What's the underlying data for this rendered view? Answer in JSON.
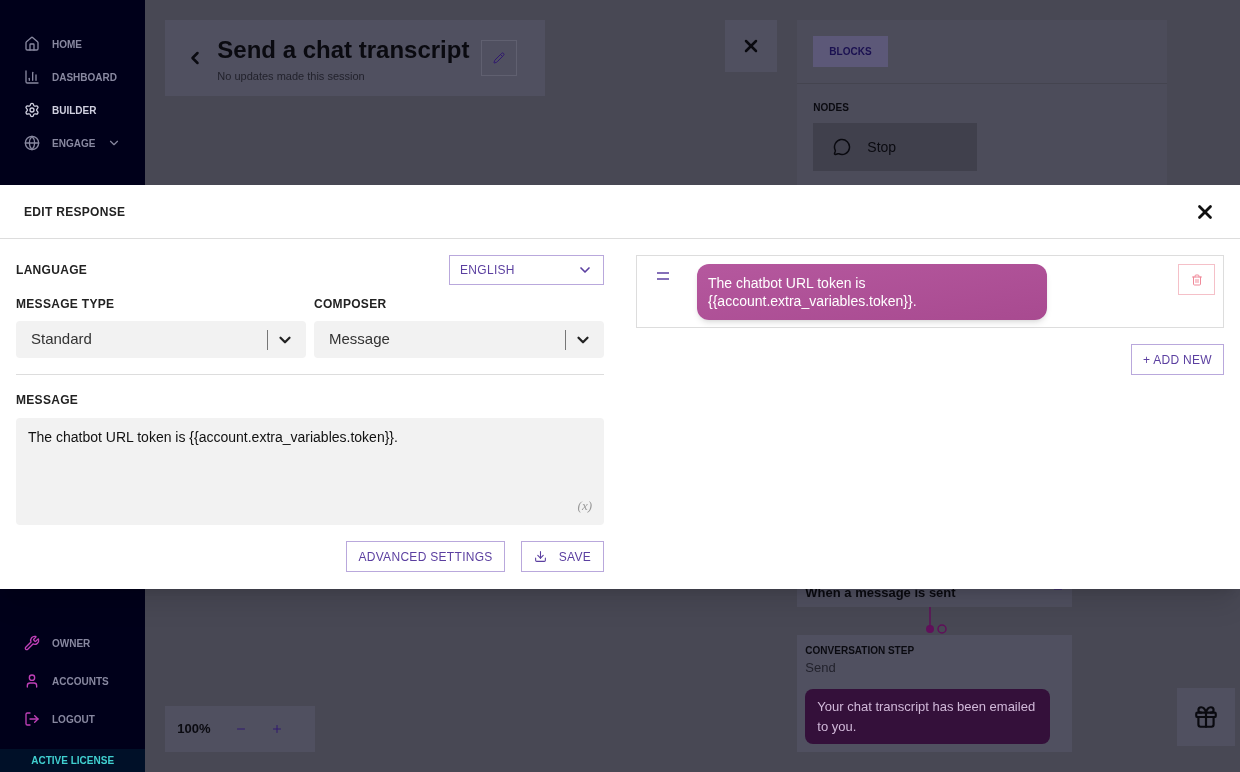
{
  "sidebar": {
    "items": [
      {
        "label": "HOME",
        "selected": false,
        "expandable": false
      },
      {
        "label": "DASHBOARD",
        "selected": false,
        "expandable": false
      },
      {
        "label": "BUILDER",
        "selected": true,
        "expandable": false
      },
      {
        "label": "ENGAGE",
        "selected": false,
        "expandable": true
      }
    ],
    "bottom_items": [
      {
        "label": "OWNER"
      },
      {
        "label": "ACCOUNTS"
      },
      {
        "label": "LOGOUT"
      }
    ],
    "license": "ACTIVE LICENSE"
  },
  "header": {
    "title": "Send a chat transcript",
    "subtitle": "No updates made this session"
  },
  "panel": {
    "tabs": [
      {
        "label": "BLOCKS",
        "selected": true
      }
    ],
    "section": "NODES",
    "nodes": [
      "Stop"
    ]
  },
  "flow": {
    "trigger": "When a message is sent",
    "step_label": "CONVERSATION STEP",
    "step_name": "Send",
    "bubble": "Your chat transcript has been emailed to you."
  },
  "zoom": "100%",
  "modal": {
    "title": "EDIT RESPONSE",
    "language": {
      "label": "LANGUAGE",
      "value": "ENGLISH"
    },
    "message_type": {
      "label": "MESSAGE TYPE",
      "value": "Standard"
    },
    "composer": {
      "label": "COMPOSER",
      "value": "Message"
    },
    "message": {
      "label": "MESSAGE",
      "value": "The chatbot URL token is {{account.extra_variables.token}}.",
      "variable_button": "(x)"
    },
    "advanced_button": "ADVANCED SETTINGS",
    "save_button": "SAVE",
    "responses": [
      {
        "text": "The chatbot URL token is {{account.extra_variables.token}}."
      }
    ],
    "add_button": "+ ADD NEW"
  }
}
